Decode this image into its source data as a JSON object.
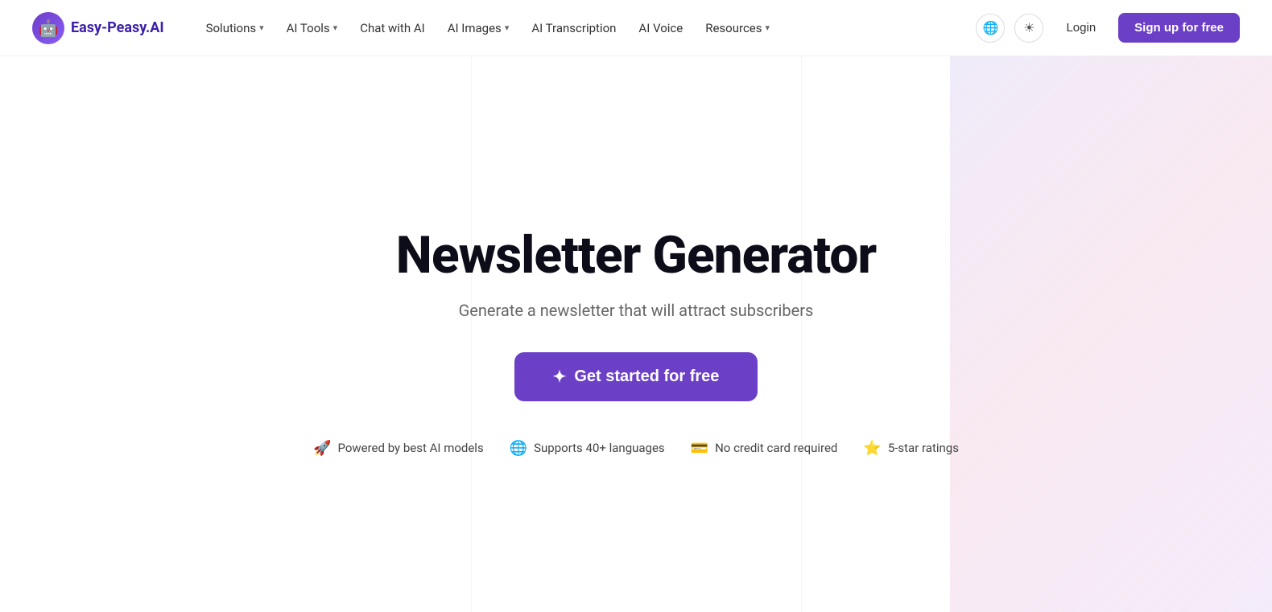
{
  "brand": {
    "logo_emoji": "🤖",
    "name": "Easy-Peasy.AI"
  },
  "nav": {
    "items": [
      {
        "label": "Solutions",
        "has_dropdown": true
      },
      {
        "label": "AI Tools",
        "has_dropdown": true
      },
      {
        "label": "Chat with AI",
        "has_dropdown": false
      },
      {
        "label": "AI Images",
        "has_dropdown": true
      },
      {
        "label": "AI Transcription",
        "has_dropdown": false
      },
      {
        "label": "AI Voice",
        "has_dropdown": false
      },
      {
        "label": "Resources",
        "has_dropdown": true
      }
    ],
    "login_label": "Login",
    "signup_label": "Sign up for free"
  },
  "hero": {
    "title": "Newsletter Generator",
    "subtitle": "Generate a newsletter that will attract subscribers",
    "cta_label": "Get started for free",
    "cta_icon": "✦"
  },
  "features": [
    {
      "icon": "🚀",
      "label": "Powered by best AI models"
    },
    {
      "icon": "🌐",
      "label": "Supports 40+ languages"
    },
    {
      "icon": "💳",
      "label": "No credit card required"
    },
    {
      "icon": "⭐",
      "label": "5-star ratings"
    }
  ],
  "icons": {
    "globe": "🌐",
    "sun": "☀",
    "chevron_down": "▾"
  }
}
